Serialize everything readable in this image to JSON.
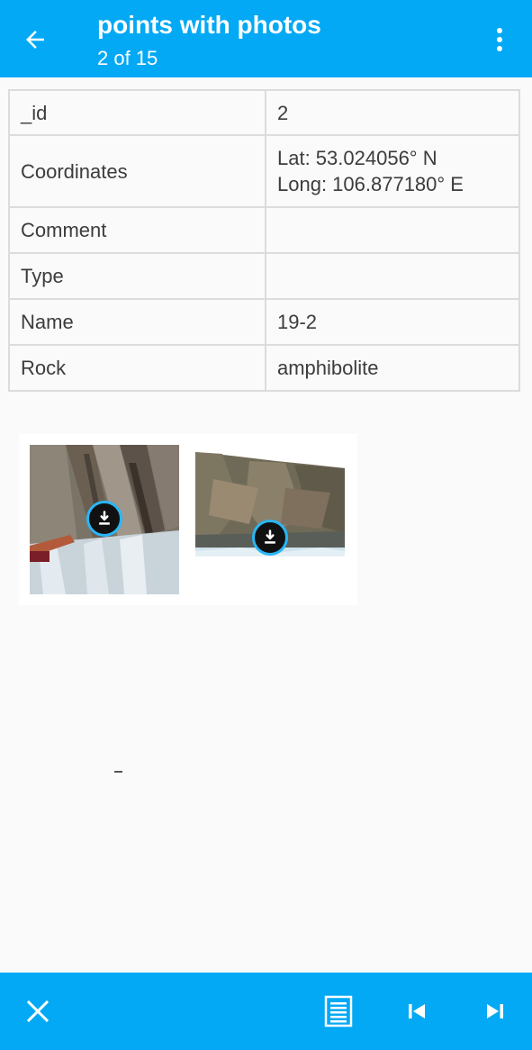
{
  "app_bar": {
    "title": "points with photos",
    "subtitle": "2 of 15",
    "back_icon": "arrow-back-icon",
    "menu_icon": "more-vert-icon",
    "color": "#03a9f4"
  },
  "attributes": [
    {
      "key": "_id",
      "value": "2"
    },
    {
      "key": "Coordinates",
      "value_lines": [
        "Lat: 53.024056° N",
        "Long: 106.877180° E"
      ]
    },
    {
      "key": "Comment",
      "value": ""
    },
    {
      "key": "Type",
      "value": ""
    },
    {
      "key": "Name",
      "value": "19-2"
    },
    {
      "key": "Rock",
      "value": "amphibolite"
    }
  ],
  "photos": {
    "count": 2,
    "overlay_icon": "download-icon"
  },
  "bottom_bar": {
    "close_icon": "close-icon",
    "list_icon": "list-icon",
    "first_icon": "skip-previous-icon",
    "last_icon": "skip-next-icon",
    "color": "#03a9f4"
  }
}
